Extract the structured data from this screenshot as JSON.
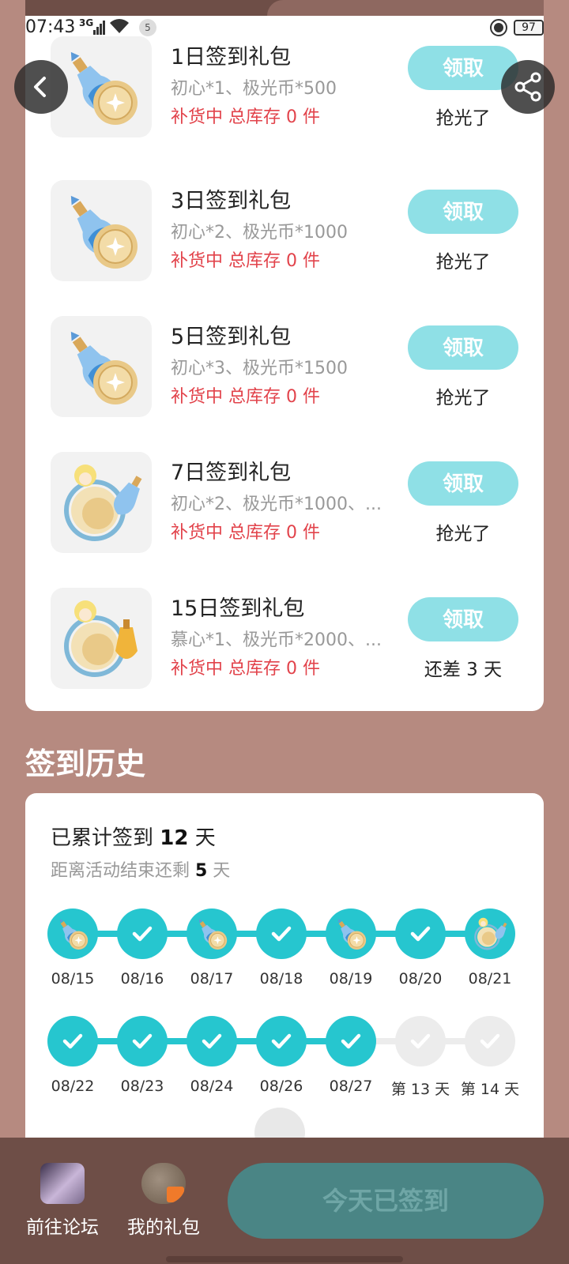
{
  "status_bar": {
    "time": "07:43",
    "network": "3G",
    "notification_count": "5",
    "battery": "97"
  },
  "gifts": [
    {
      "title": "1日签到礼包",
      "desc": "初心*1、极光币*500",
      "stock": "补货中 总库存 0 件",
      "claim_label": "领取",
      "status": "抢光了",
      "icon": "potion-coin-icon"
    },
    {
      "title": "3日签到礼包",
      "desc": "初心*2、极光币*1000",
      "stock": "补货中 总库存 0 件",
      "claim_label": "领取",
      "status": "抢光了",
      "icon": "potion-coin-icon"
    },
    {
      "title": "5日签到礼包",
      "desc": "初心*3、极光币*1500",
      "stock": "补货中 总库存 0 件",
      "claim_label": "领取",
      "status": "抢光了",
      "icon": "potion-coin-icon"
    },
    {
      "title": "7日签到礼包",
      "desc": "初心*2、极光币*1000、...",
      "stock": "补货中 总库存 0 件",
      "claim_label": "领取",
      "status": "抢光了",
      "icon": "frame-potion-icon"
    },
    {
      "title": "15日签到礼包",
      "desc": "慕心*1、极光币*2000、...",
      "stock": "补货中 总库存 0 件",
      "claim_label": "领取",
      "status": "还差 3 天",
      "icon": "frame-lantern-icon"
    }
  ],
  "history": {
    "section_title": "签到历史",
    "total_prefix": "已累计签到 ",
    "total_days": "12",
    "total_suffix": " 天",
    "remain_prefix": "距离活动结束还剩 ",
    "remain_days": "5",
    "remain_suffix": " 天",
    "row1": [
      {
        "label": "08/15",
        "state": "gift",
        "icon": "potion-coin-icon"
      },
      {
        "label": "08/16",
        "state": "checked",
        "icon": "check-icon"
      },
      {
        "label": "08/17",
        "state": "gift",
        "icon": "potion-coin-icon"
      },
      {
        "label": "08/18",
        "state": "checked",
        "icon": "check-icon"
      },
      {
        "label": "08/19",
        "state": "gift",
        "icon": "potion-coin-icon"
      },
      {
        "label": "08/20",
        "state": "checked",
        "icon": "check-icon"
      },
      {
        "label": "08/21",
        "state": "gift",
        "icon": "frame-potion-icon"
      }
    ],
    "row2": [
      {
        "label": "08/22",
        "state": "checked",
        "icon": "check-icon"
      },
      {
        "label": "08/23",
        "state": "checked",
        "icon": "check-icon"
      },
      {
        "label": "08/24",
        "state": "checked",
        "icon": "check-icon"
      },
      {
        "label": "08/26",
        "state": "checked",
        "icon": "check-icon"
      },
      {
        "label": "08/27",
        "state": "checked",
        "icon": "check-icon"
      },
      {
        "label": "第 13 天",
        "state": "pending",
        "icon": "check-icon"
      },
      {
        "label": "第 14 天",
        "state": "pending",
        "icon": "check-icon"
      }
    ]
  },
  "bottom_bar": {
    "forum_label": "前往论坛",
    "gifts_label": "我的礼包",
    "checkin_label": "今天已签到"
  },
  "colors": {
    "accent": "#26c6cf",
    "claim_button": "#8fe0e6",
    "stock_red": "#e2434b",
    "background": "#b68a80",
    "bottom_bar": "#6e4e47",
    "checkin_button": "#4a8585"
  }
}
